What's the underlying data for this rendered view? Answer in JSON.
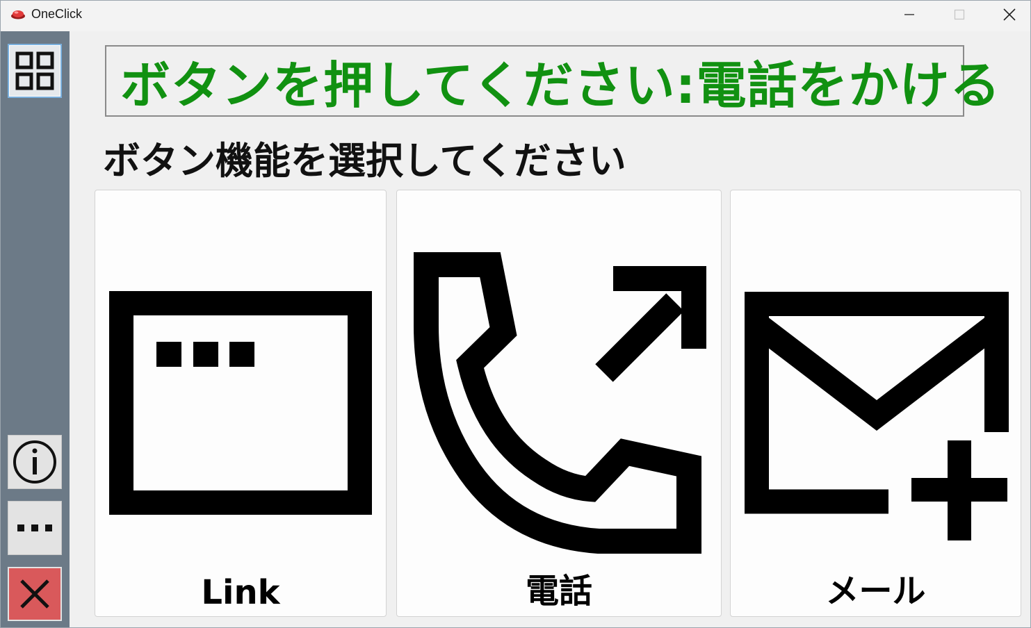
{
  "window": {
    "title": "OneClick",
    "brand_color": "#d32f2f"
  },
  "titlebar_buttons": {
    "minimize_icon": "minimize-icon",
    "maximize_icon": "maximize-icon",
    "close_icon": "close-icon"
  },
  "sidebar": {
    "items": [
      {
        "icon": "grid-icon",
        "selected": true
      },
      {
        "icon": "info-icon"
      },
      {
        "icon": "more-icon"
      },
      {
        "icon": "close-icon",
        "color": "#d9595b"
      }
    ]
  },
  "status": {
    "text": "ボタンを押してください:電話をかける",
    "color": "#119111"
  },
  "subtitle": "ボタン機能を選択してください",
  "functions": [
    {
      "icon": "browser-window-icon",
      "label": "Link"
    },
    {
      "icon": "phone-outgoing-icon",
      "label": "電話"
    },
    {
      "icon": "mail-add-icon",
      "label": "メール"
    }
  ]
}
